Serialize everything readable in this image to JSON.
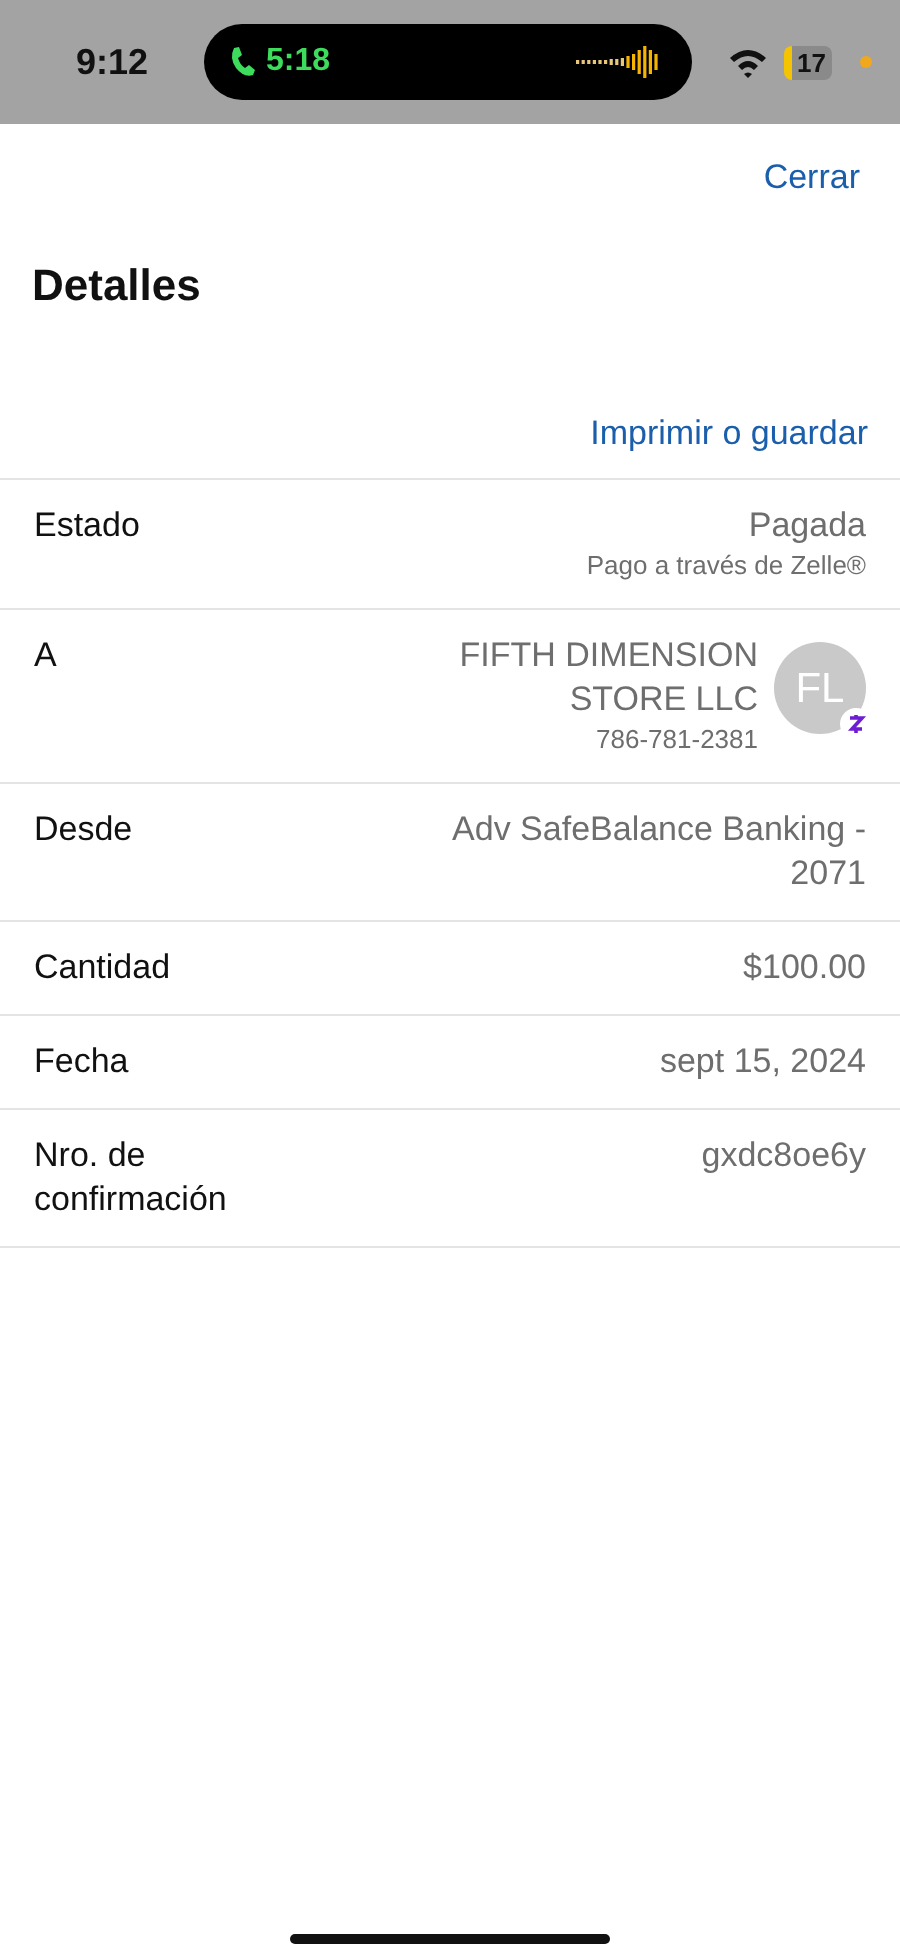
{
  "status_bar": {
    "time": "9:12",
    "call_time": "5:18",
    "battery": "17"
  },
  "header": {
    "close": "Cerrar",
    "title": "Detalles",
    "print": "Imprimir o guardar"
  },
  "rows": [
    {
      "kind": "status",
      "label": "Estado",
      "value": "Pagada",
      "sub": "Pago a través de Zelle®"
    },
    {
      "kind": "payee",
      "label": "A",
      "value": "FIFTH DIMENSION STORE LLC",
      "sub": "786-781-2381",
      "avatar": "FL"
    },
    {
      "kind": "plain",
      "label": "Desde",
      "value": "Adv SafeBalance Banking - 2071"
    },
    {
      "kind": "plain",
      "label": "Cantidad",
      "value": "$100.00"
    },
    {
      "kind": "plain",
      "label": "Fecha",
      "value": "sept 15, 2024"
    },
    {
      "kind": "plain",
      "label": "Nro. de confirmación",
      "value": "gxdc8oe6y"
    }
  ]
}
